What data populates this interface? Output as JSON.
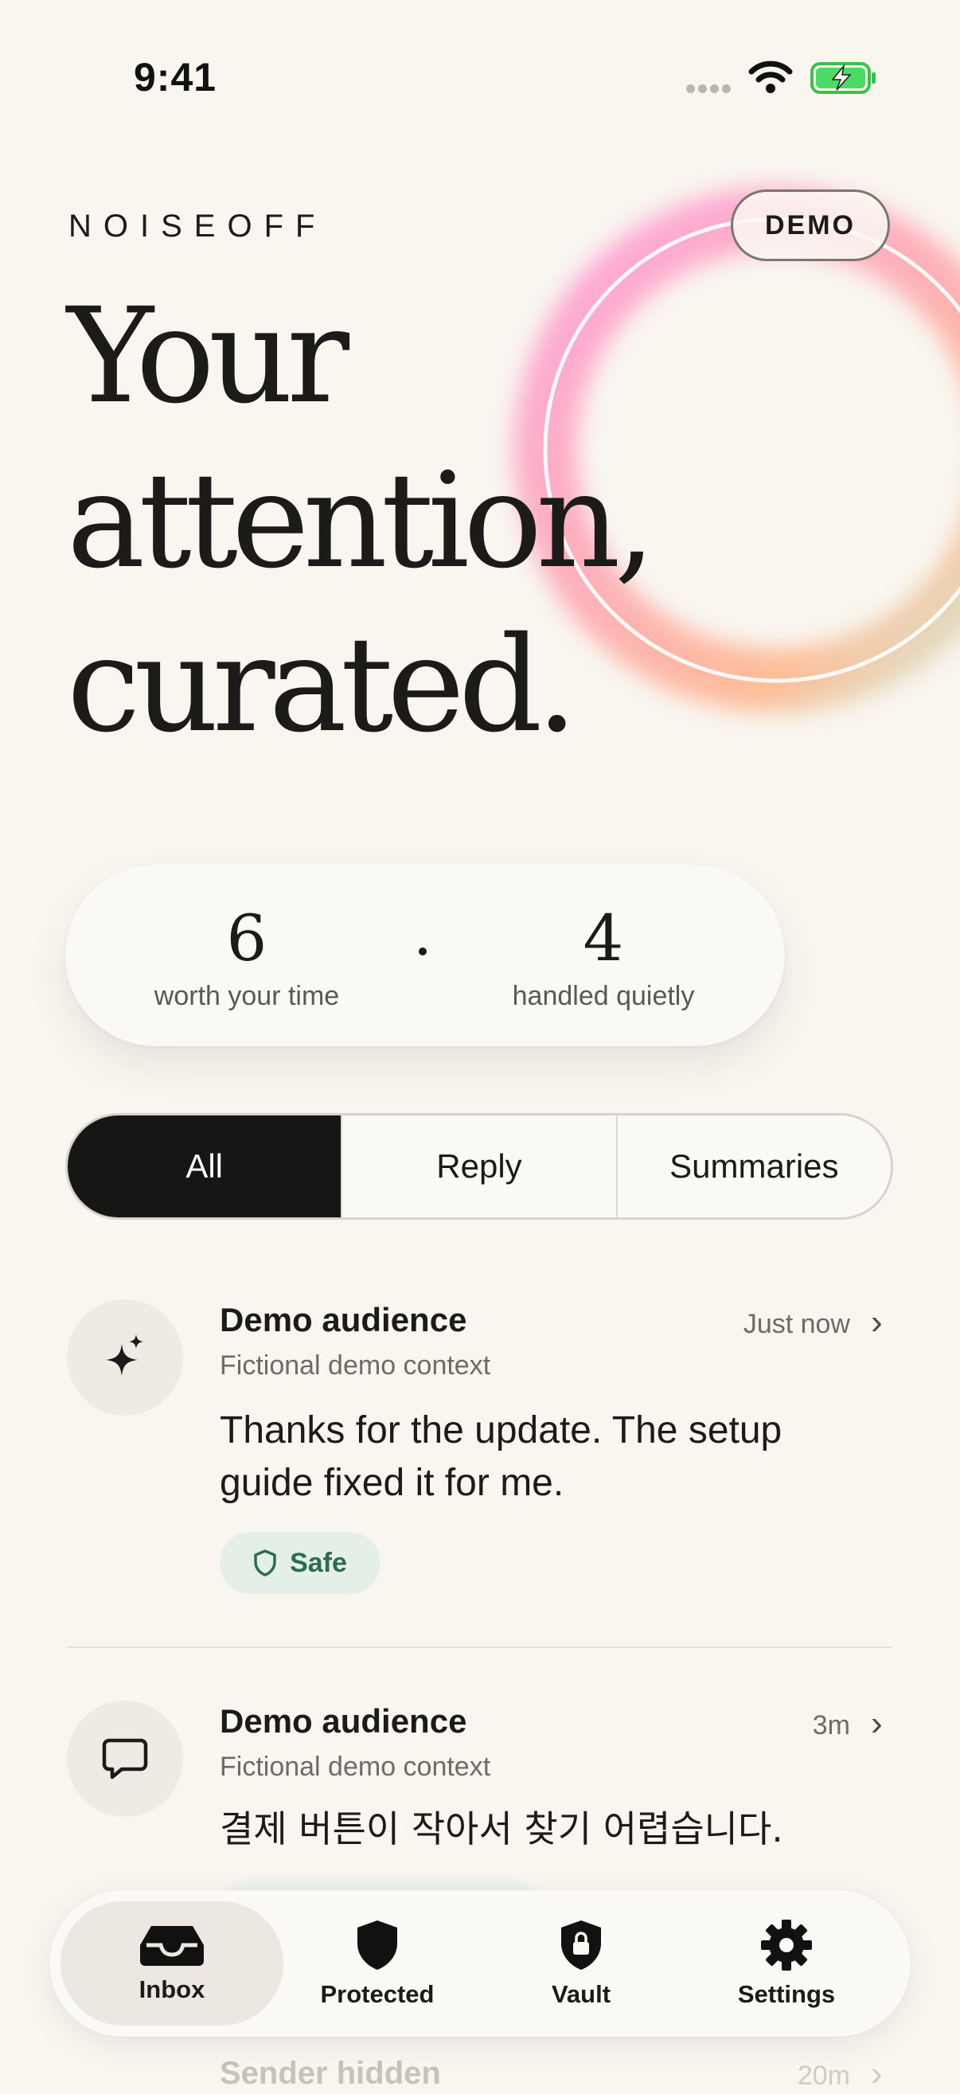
{
  "status_bar": {
    "time": "9:41"
  },
  "brand": "NOISEOFF",
  "mode_badge": "DEMO",
  "hero": [
    "Your",
    "attention,",
    "curated."
  ],
  "stats": {
    "worth": {
      "value": "6",
      "label": "worth your time"
    },
    "handled": {
      "value": "4",
      "label": "handled quietly"
    }
  },
  "filters": {
    "selected": "All",
    "items": [
      "All",
      "Reply",
      "Summaries"
    ]
  },
  "messages": [
    {
      "icon": "sparkle-icon",
      "sender": "Demo audience",
      "context": "Fictional demo context",
      "time": "Just now",
      "text": "Thanks for the update. The setup guide fixed it for me.",
      "badge": "Safe"
    },
    {
      "icon": "chat-bubble-icon",
      "sender": "Demo audience",
      "context": "Fictional demo context",
      "time": "3m",
      "text": "결제 버튼이 작아서 찾기 어렵습니다."
    },
    {
      "sender": "Sender hidden",
      "time": "20m"
    }
  ],
  "tabs": [
    {
      "label": "Inbox",
      "icon": "inbox-icon",
      "selected": true
    },
    {
      "label": "Protected",
      "icon": "shield-icon",
      "selected": false
    },
    {
      "label": "Vault",
      "icon": "lock-shield-icon",
      "selected": false
    },
    {
      "label": "Settings",
      "icon": "gear-icon",
      "selected": false
    }
  ],
  "colors": {
    "background": "#f9f6f0",
    "ink": "#1c1b19",
    "safe_green": "#2f6b50",
    "safe_bg": "#e4efe8",
    "ring_pink": "#ff8fd6",
    "ring_orange": "#ffab7a",
    "ring_mint": "#bff2dc"
  }
}
